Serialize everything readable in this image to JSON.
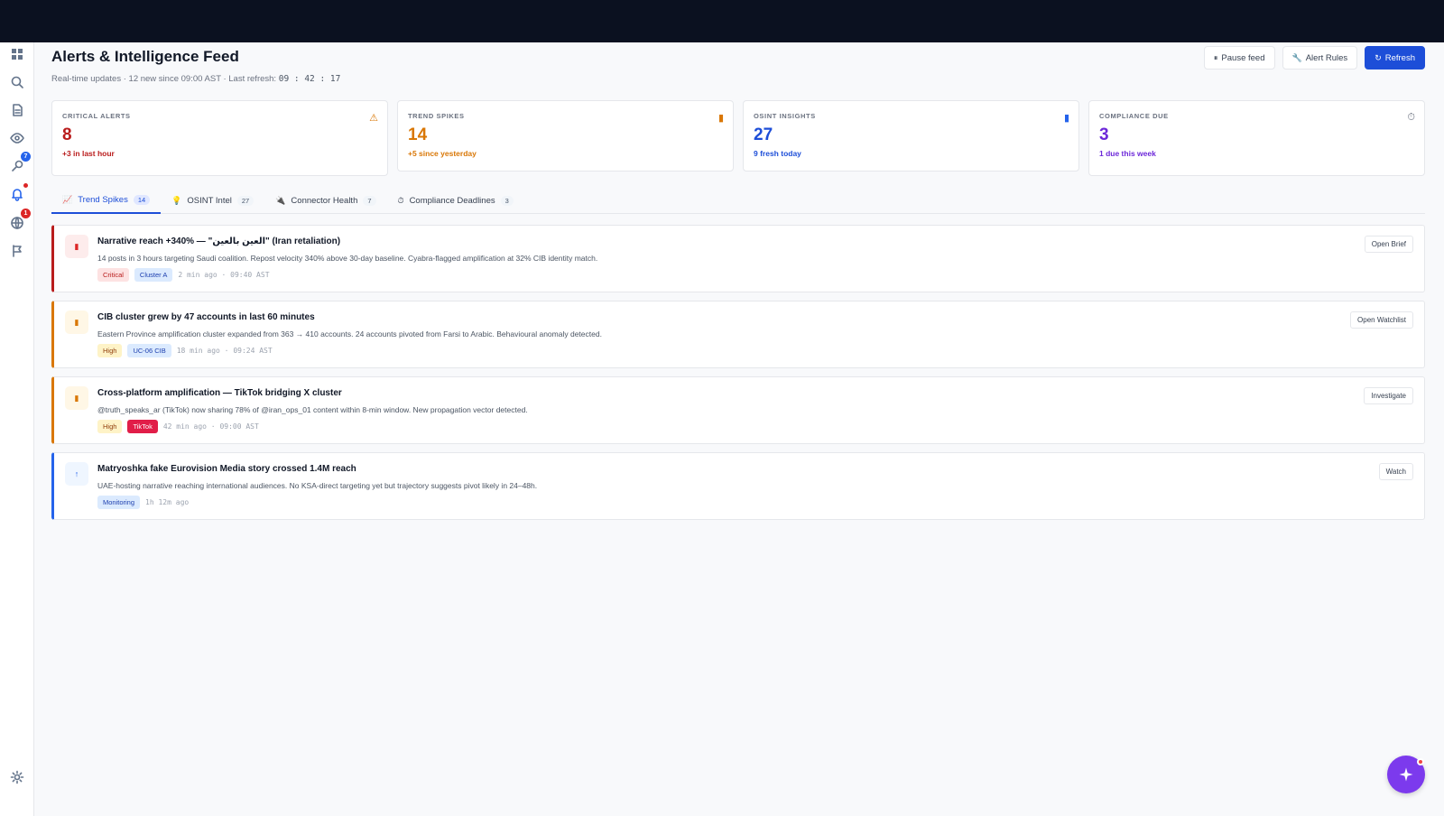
{
  "header": {
    "title": "Alerts & Intelligence Feed",
    "subtitle": "Real-time updates · 12 new since 09:00 AST · Last refresh: ",
    "last_refresh": "09 : 42 : 17"
  },
  "actions": {
    "pause": {
      "icon": "⏸",
      "label": "Pause feed"
    },
    "rules": {
      "icon": "🔧",
      "label": "Alert Rules"
    },
    "refresh": {
      "icon": "↻",
      "label": "Refresh"
    }
  },
  "sidebar": {
    "badge_investigate": "7",
    "badge_globe": "1"
  },
  "stats": [
    {
      "label": "CRITICAL ALERTS",
      "value": "8",
      "sub": "+3 in last hour",
      "icon": "⚠",
      "color": "#b91c1c",
      "icon_color": "#d97706"
    },
    {
      "label": "TREND SPIKES",
      "value": "14",
      "sub": "+5 since yesterday",
      "icon": "▮",
      "color": "#d97706",
      "icon_color": "#d97706"
    },
    {
      "label": "OSINT INSIGHTS",
      "value": "27",
      "sub": "9 fresh today",
      "icon": "▮",
      "color": "#1d4ed8",
      "icon_color": "#2563eb"
    },
    {
      "label": "COMPLIANCE DUE",
      "value": "3",
      "sub": "1 due this week",
      "icon": "⏱",
      "color": "#6d28d9",
      "icon_color": "#6b7280"
    }
  ],
  "tabs": [
    {
      "icon": "📈",
      "label": "Trend Spikes",
      "count": "14"
    },
    {
      "icon": "💡",
      "label": "OSINT Intel",
      "count": "27"
    },
    {
      "icon": "🔌",
      "label": "Connector Health",
      "count": "7"
    },
    {
      "icon": "⏱",
      "label": "Compliance Deadlines",
      "count": "3"
    }
  ],
  "alerts": [
    {
      "icon": "▮",
      "title": "Narrative reach +340% — \"العين بالعين\" (Iran retaliation)",
      "desc": "14 posts in 3 hours targeting Saudi coalition. Repost velocity 340% above 30-day baseline. Cyabra-flagged amplification at 32% CIB identity match.",
      "tags": [
        "Critical",
        "Cluster A"
      ],
      "time": "2 min ago · 09:40 AST",
      "action": "Open Brief"
    },
    {
      "icon": "▮",
      "title": "CIB cluster grew by 47 accounts in last 60 minutes",
      "desc": "Eastern Province amplification cluster expanded from 363 → 410 accounts. 24 accounts pivoted from Farsi to Arabic. Behavioural anomaly detected.",
      "tags": [
        "High",
        "UC-06 CIB"
      ],
      "time": "18 min ago · 09:24 AST",
      "action": "Open Watchlist"
    },
    {
      "icon": "▮",
      "title": "Cross-platform amplification — TikTok bridging X cluster",
      "desc": "@truth_speaks_ar (TikTok) now sharing 78% of @iran_ops_01 content within 8-min window. New propagation vector detected.",
      "tags": [
        "High",
        "TikTok"
      ],
      "time": "42 min ago · 09:00 AST",
      "action": "Investigate"
    },
    {
      "icon": "↑",
      "title": "Matryoshka fake Eurovision Media story crossed 1.4M reach",
      "desc": "UAE-hosting narrative reaching international audiences. No KSA-direct targeting yet but trajectory suggests pivot likely in 24–48h.",
      "tags": [
        "Monitoring"
      ],
      "time": "1h 12m ago",
      "action": "Watch"
    }
  ]
}
